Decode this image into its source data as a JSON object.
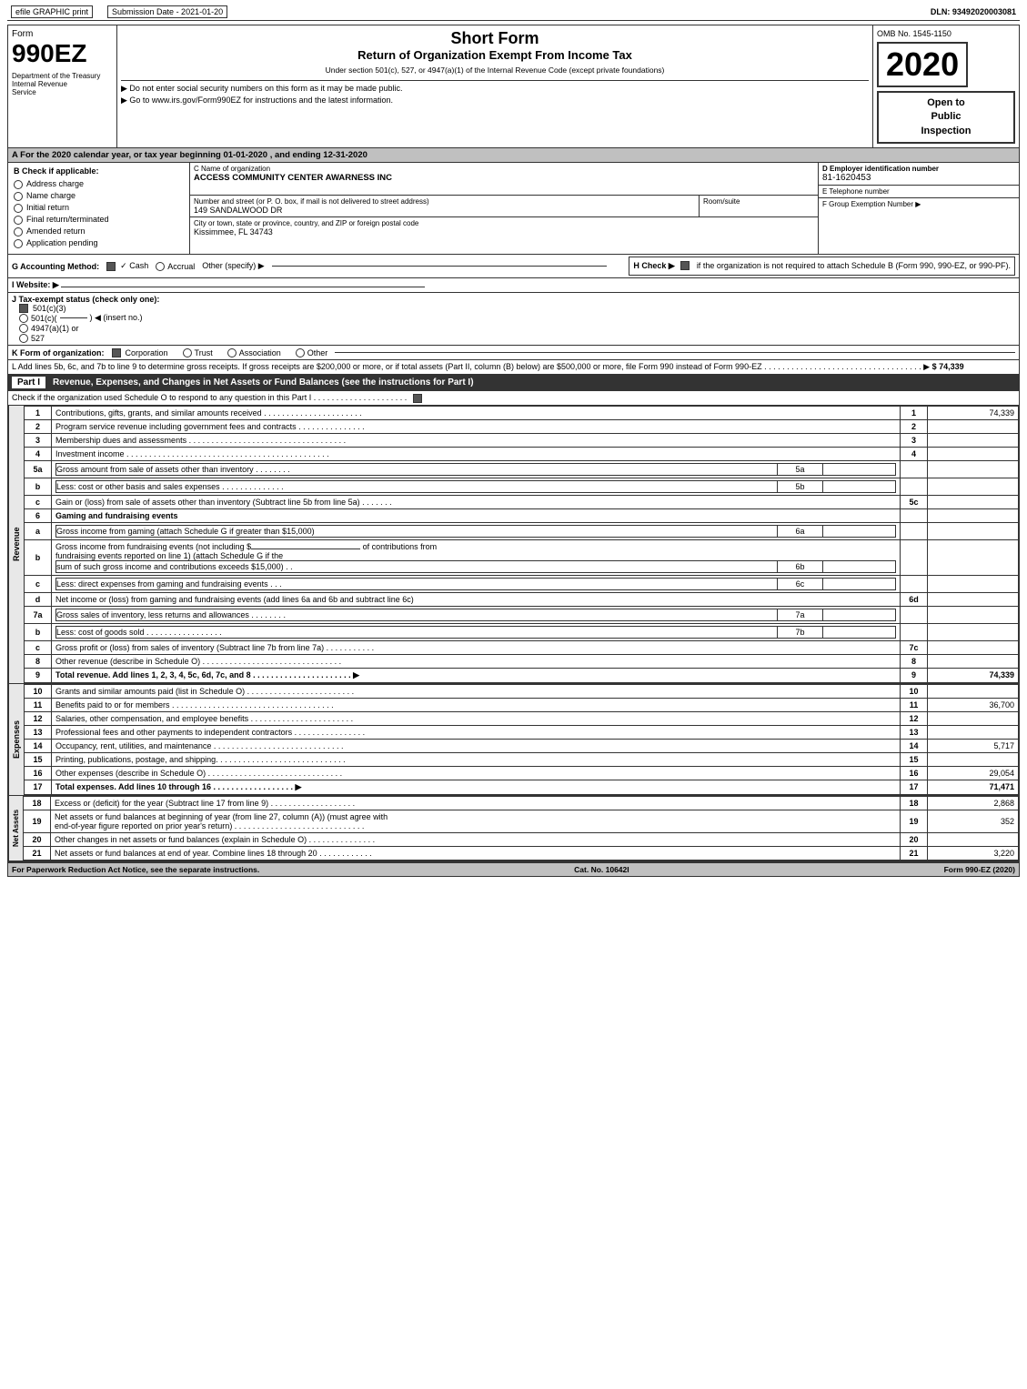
{
  "topBar": {
    "left": {
      "label1": "efile GRAPHIC print",
      "label2": "Submission Date - 2021-01-20"
    },
    "right": {
      "dln": "DLN: 93492020003081"
    }
  },
  "formHeader": {
    "formLabel": "Form",
    "formNumber": "990EZ",
    "title": "Short Form",
    "subtitle": "Return of Organization Exempt From Income Tax",
    "underSection": "Under section 501(c), 527, or 4947(a)(1) of the Internal Revenue Code (except private foundations)",
    "notice1": "▶ Do not enter social security numbers on this form as it may be made public.",
    "notice2": "▶ Go to www.irs.gov/Form990EZ for instructions and the latest information.",
    "year": "2020",
    "ombNo": "OMB No. 1545-1150",
    "openToPublic": "Open to\nPublic\nInspection",
    "dept": "Department of the Treasury",
    "bureau": "Internal Revenue",
    "service": "Service"
  },
  "sectionA": {
    "label": "A  For the 2020 calendar year, or tax year beginning 01-01-2020 , and ending 12-31-2020"
  },
  "checkIfApplicable": {
    "label": "B  Check if applicable:",
    "items": [
      {
        "id": "address-change",
        "label": "Address change",
        "checked": false
      },
      {
        "id": "name-change",
        "label": "Name change",
        "checked": false
      },
      {
        "id": "initial-return",
        "label": "Initial return",
        "checked": false
      },
      {
        "id": "final-return",
        "label": "Final return/terminated",
        "checked": false
      },
      {
        "id": "amended-return",
        "label": "Amended return",
        "checked": false
      },
      {
        "id": "application-pending",
        "label": "Application pending",
        "checked": false
      }
    ]
  },
  "orgInfo": {
    "nameLabel": "C Name of organization",
    "nameValue": "ACCESS COMMUNITY CENTER AWARNESS INC",
    "addressLabel": "Number and street (or P. O. box, if mail is not delivered to street address)",
    "addressValue": "149 SANDALWOOD DR",
    "roomSuiteLabel": "Room/suite",
    "roomSuiteValue": "",
    "cityLabel": "City or town, state or province, country, and ZIP or foreign postal code",
    "cityValue": "Kissimmee, FL  34743",
    "einLabel": "D Employer identification number",
    "einValue": "81-1620453",
    "phoneLabel": "E Telephone number",
    "phoneValue": "",
    "groupExemptLabel": "F Group Exemption Number",
    "groupExemptSymbol": "▶"
  },
  "sectionG": {
    "label": "G Accounting Method:",
    "cashLabel": "✓ Cash",
    "accrualLabel": "○ Accrual",
    "otherLabel": "Other (specify) ▶",
    "cashChecked": true
  },
  "sectionH": {
    "label": "H  Check ▶",
    "checkboxChecked": true,
    "text": "if the organization is not required to attach Schedule B (Form 990, 990-EZ, or 990-PF)."
  },
  "sectionI": {
    "label": "I Website: ▶"
  },
  "sectionJ": {
    "label": "J Tax-exempt status (check only one):",
    "options": [
      {
        "label": "✓ 501(c)(3)",
        "selected": true
      },
      {
        "label": "○ 501(c)(",
        "selected": false
      },
      {
        "label": ") ◀ (insert no.)",
        "selected": false
      },
      {
        "label": "○ 4947(a)(1) or",
        "selected": false
      },
      {
        "label": "○ 527",
        "selected": false
      }
    ]
  },
  "sectionK": {
    "label": "K Form of organization:",
    "options": [
      {
        "label": "✓ Corporation",
        "selected": true
      },
      {
        "label": "○ Trust",
        "selected": false
      },
      {
        "label": "○ Association",
        "selected": false
      },
      {
        "label": "○ Other",
        "selected": false
      }
    ]
  },
  "sectionL": {
    "text": "L Add lines 5b, 6c, and 7b to line 9 to determine gross receipts. If gross receipts are $200,000 or more, or if total assets (Part II, column (B) below) are $500,000 or more, file Form 990 instead of Form 990-EZ . . . . . . . . . . . . . . . . . . . . . . . . . . . . . . . . . . . ▶",
    "value": "$ 74,339"
  },
  "partI": {
    "label": "Part I",
    "title": "Revenue, Expenses, and Changes in Net Assets or Fund Balances (see the instructions for Part I)",
    "checkLine": "Check if the organization used Schedule O to respond to any question in this Part I . . . . . . . . . . . . . . . . . . . . .",
    "checkboxChecked": true,
    "rows": [
      {
        "num": "1",
        "desc": "Contributions, gifts, grants, and similar amounts received . . . . . . . . . . . . . . . . . . . . . .",
        "lineRef": "1",
        "amount": "74,339",
        "bold": false,
        "indent": 0
      },
      {
        "num": "2",
        "desc": "Program service revenue including government fees and contracts . . . . . . . . . . . . . . .",
        "lineRef": "2",
        "amount": "",
        "bold": false,
        "indent": 0
      },
      {
        "num": "3",
        "desc": "Membership dues and assessments . . . . . . . . . . . . . . . . . . . . . . . . . . . . . . . . . . .",
        "lineRef": "3",
        "amount": "",
        "bold": false,
        "indent": 0
      },
      {
        "num": "4",
        "desc": "Investment income . . . . . . . . . . . . . . . . . . . . . . . . . . . . . . . . . . . . . . . . . . . . .",
        "lineRef": "4",
        "amount": "",
        "bold": false,
        "indent": 0
      },
      {
        "num": "5a",
        "desc": "Gross amount from sale of assets other than inventory . . . . . . . .",
        "lineRef": "5a",
        "amount": "",
        "bold": false,
        "indent": 0,
        "subLine": true
      },
      {
        "num": "b",
        "desc": "Less: cost or other basis and sales expenses . . . . . . . . . . . . . .",
        "lineRef": "5b",
        "amount": "",
        "bold": false,
        "indent": 1,
        "subLine": true
      },
      {
        "num": "c",
        "desc": "Gain or (loss) from sale of assets other than inventory (Subtract line 5b from line 5a) . . . . . . .",
        "lineRef": "5c",
        "amount": "",
        "bold": false,
        "indent": 1
      },
      {
        "num": "6",
        "desc": "Gaming and fundraising events",
        "lineRef": "",
        "amount": "",
        "bold": false,
        "indent": 0,
        "noAmount": true
      },
      {
        "num": "a",
        "desc": "Gross income from gaming (attach Schedule G if greater than $15,000)",
        "lineRef": "6a",
        "amount": "",
        "bold": false,
        "indent": 1,
        "subLine": true
      },
      {
        "num": "b",
        "desc": "Gross income from fundraising events (not including $                           of contributions from fundraising events reported on line 1) (attach Schedule G if the sum of such gross income and contributions exceeds $15,000)     .    .",
        "lineRef": "6b",
        "amount": "",
        "bold": false,
        "indent": 1,
        "multiLine": true,
        "subLine": true
      },
      {
        "num": "c",
        "desc": "Less: direct expenses from gaming and fundraising events     .    .    .",
        "lineRef": "6c",
        "amount": "",
        "bold": false,
        "indent": 1,
        "subLine": true
      },
      {
        "num": "d",
        "desc": "Net income or (loss) from gaming and fundraising events (add lines 6a and 6b and subtract line 6c)",
        "lineRef": "6d",
        "amount": "",
        "bold": false,
        "indent": 0
      },
      {
        "num": "7a",
        "desc": "Gross sales of inventory, less returns and allowances . . . . . . . .",
        "lineRef": "7a",
        "amount": "",
        "bold": false,
        "indent": 0,
        "subLine": true
      },
      {
        "num": "b",
        "desc": "Less: cost of goods sold     .    .    .    .    .    .    .    .    .    .    .    .    .    .    .    .    .",
        "lineRef": "7b",
        "amount": "",
        "bold": false,
        "indent": 1,
        "subLine": true
      },
      {
        "num": "c",
        "desc": "Gross profit or (loss) from sales of inventory (Subtract line 7b from line 7a) . . . . . . . . . . .",
        "lineRef": "7c",
        "amount": "",
        "bold": false,
        "indent": 1
      },
      {
        "num": "8",
        "desc": "Other revenue (describe in Schedule O) . . . . . . . . . . . . . . . . . . . . . . . . . . . . . . .",
        "lineRef": "8",
        "amount": "",
        "bold": false,
        "indent": 0
      },
      {
        "num": "9",
        "desc": "Total revenue. Add lines 1, 2, 3, 4, 5c, 6d, 7c, and 8 . . . . . . . . . . . . . . . . . . . . . . ▶",
        "lineRef": "9",
        "amount": "74,339",
        "bold": true,
        "indent": 0
      }
    ]
  },
  "partIExpenses": {
    "rows": [
      {
        "num": "10",
        "desc": "Grants and similar amounts paid (list in Schedule O) . . . . . . . . . . . . . . . . . . . . . . . .",
        "lineRef": "10",
        "amount": "",
        "bold": false
      },
      {
        "num": "11",
        "desc": "Benefits paid to or for members . . . . . . . . . . . . . . . . . . . . . . . . . . . . . . . . . . . .",
        "lineRef": "11",
        "amount": "36,700",
        "bold": false
      },
      {
        "num": "12",
        "desc": "Salaries, other compensation, and employee benefits . . . . . . . . . . . . . . . . . . . . . . .",
        "lineRef": "12",
        "amount": "",
        "bold": false
      },
      {
        "num": "13",
        "desc": "Professional fees and other payments to independent contractors . . . . . . . . . . . . . . . .",
        "lineRef": "13",
        "amount": "",
        "bold": false
      },
      {
        "num": "14",
        "desc": "Occupancy, rent, utilities, and maintenance . . . . . . . . . . . . . . . . . . . . . . . . . . . . .",
        "lineRef": "14",
        "amount": "5,717",
        "bold": false
      },
      {
        "num": "15",
        "desc": "Printing, publications, postage, and shipping. . . . . . . . . . . . . . . . . . . . . . . . . . . . .",
        "lineRef": "15",
        "amount": "",
        "bold": false
      },
      {
        "num": "16",
        "desc": "Other expenses (describe in Schedule O) . . . . . . . . . . . . . . . . . . . . . . . . . . . . . .",
        "lineRef": "16",
        "amount": "29,054",
        "bold": false
      },
      {
        "num": "17",
        "desc": "Total expenses. Add lines 10 through 16     .    .    .    .    .    .    .    .    .    .    .    .    .    .    .    .    .    .   ▶",
        "lineRef": "17",
        "amount": "71,471",
        "bold": true
      }
    ]
  },
  "partINetAssets": {
    "rows": [
      {
        "num": "18",
        "desc": "Excess or (deficit) for the year (Subtract line 17 from line 9)     .    .    .    .    .    .    .    .    .    .    .    .    .    .    .    .    .    .    .",
        "lineRef": "18",
        "amount": "2,868",
        "bold": false
      },
      {
        "num": "19",
        "desc": "Net assets or fund balances at beginning of year (from line 27, column (A)) (must agree with end-of-year figure reported on prior year's return) . . . . . . . . . . . . . . . . . . . . . . . . . . . . .",
        "lineRef": "19",
        "amount": "352",
        "bold": false,
        "multiLine": true
      },
      {
        "num": "20",
        "desc": "Other changes in net assets or fund balances (explain in Schedule O) . . . . . . . . . . . . . . .",
        "lineRef": "20",
        "amount": "",
        "bold": false
      },
      {
        "num": "21",
        "desc": "Net assets or fund balances at end of year. Combine lines 18 through 20 . . . . . . . . . . . .",
        "lineRef": "21",
        "amount": "3,220",
        "bold": false
      }
    ]
  },
  "footer": {
    "left": "For Paperwork Reduction Act Notice, see the separate instructions.",
    "middle": "Cat. No. 10642I",
    "right": "Form 990-EZ (2020)"
  }
}
